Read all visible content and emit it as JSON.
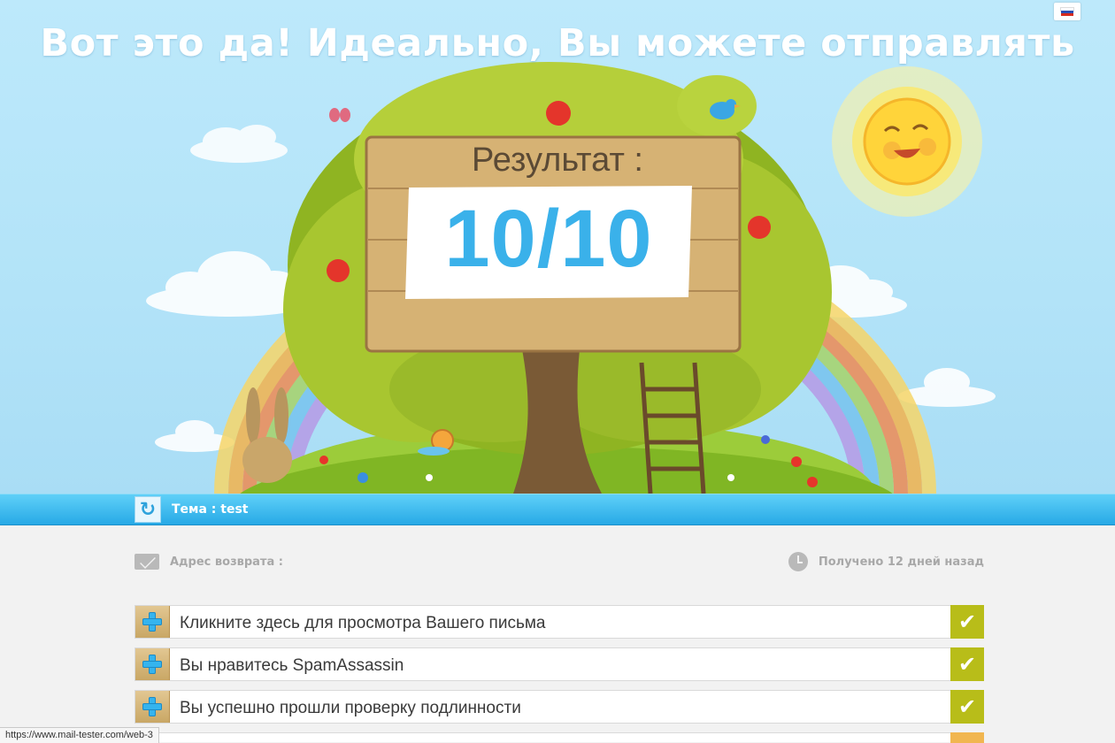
{
  "hero": {
    "headline": "Вот это да! Идеально, Вы можете отправлять",
    "result_label": "Результат :",
    "score": "10/10",
    "language_flag": "ru-flag-icon"
  },
  "subject": {
    "text": "Тема : test",
    "refresh_icon": "refresh-icon"
  },
  "meta": {
    "return_address_label": "Адрес возврата :",
    "received_label": "Получено 12 дней назад"
  },
  "checks": [
    {
      "label": "Кликните здесь для просмотра Вашего письма",
      "status": "pass"
    },
    {
      "label": "Вы нравитесь SpamAssassin",
      "status": "pass"
    },
    {
      "label": "Вы успешно прошли проверку подлинности",
      "status": "pass"
    }
  ],
  "status_bar": {
    "url": "https://www.mail-tester.com/web-3"
  },
  "colors": {
    "sky": "#b2e3f8",
    "score_blue": "#3ab1ea",
    "bar_blue": "#27a9e6",
    "pass_green": "#b8bd19",
    "partial_orange": "#f1b650"
  }
}
